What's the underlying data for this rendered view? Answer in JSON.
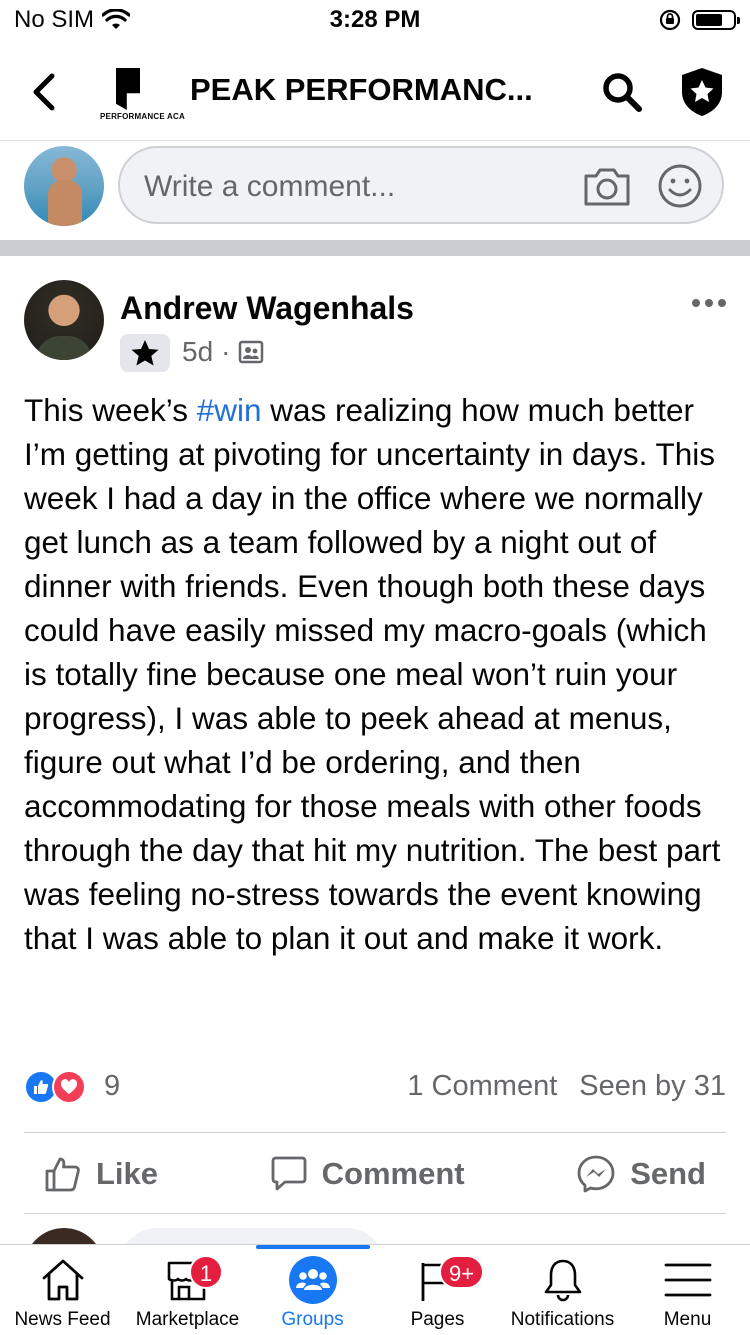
{
  "status_bar": {
    "carrier": "No SIM",
    "time": "3:28 PM"
  },
  "header": {
    "group_name": "PEAK PERFORMANC...",
    "logo_text": "PERFORMANCE ACA"
  },
  "composer": {
    "placeholder": "Write a comment..."
  },
  "post": {
    "author": "Andrew Wagenhals",
    "time_ago": "5d",
    "separator": "·",
    "text_before": "This week’s ",
    "hashtag": "#win",
    "text_after": " was realizing how much better I’m getting at pivoting for uncertainty in days. This week I had a day in the office where we normally get lunch as a team followed by a night out of dinner with friends. Even though both these days could have easily missed my macro-goals (which is totally fine because one meal won’t ruin your progress), I was able to peek ahead at menus, figure out what I’d be ordering, and then accommodating for those meals with other foods through the day that hit my nutrition. The best part was feeling no-stress towards the event knowing that I was able to plan it out and make it work.",
    "reaction_count": "9",
    "comments_text": "1 Comment",
    "seen_text": "Seen by 31",
    "actions": {
      "like": "Like",
      "comment": "Comment",
      "send": "Send"
    }
  },
  "tabbar": {
    "items": [
      {
        "label": "News Feed",
        "icon": "home-icon"
      },
      {
        "label": "Marketplace",
        "icon": "shop-icon",
        "badge": "1"
      },
      {
        "label": "Groups",
        "icon": "groups-icon",
        "active": true
      },
      {
        "label": "Pages",
        "icon": "flag-icon",
        "badge": "9+"
      },
      {
        "label": "Notifications",
        "icon": "bell-icon"
      },
      {
        "label": "Menu",
        "icon": "hamburger-icon"
      }
    ]
  },
  "colors": {
    "accent": "#1877f2",
    "badge": "#e41e3f",
    "secondary_text": "#65676b",
    "hashtag": "#216fdb"
  }
}
